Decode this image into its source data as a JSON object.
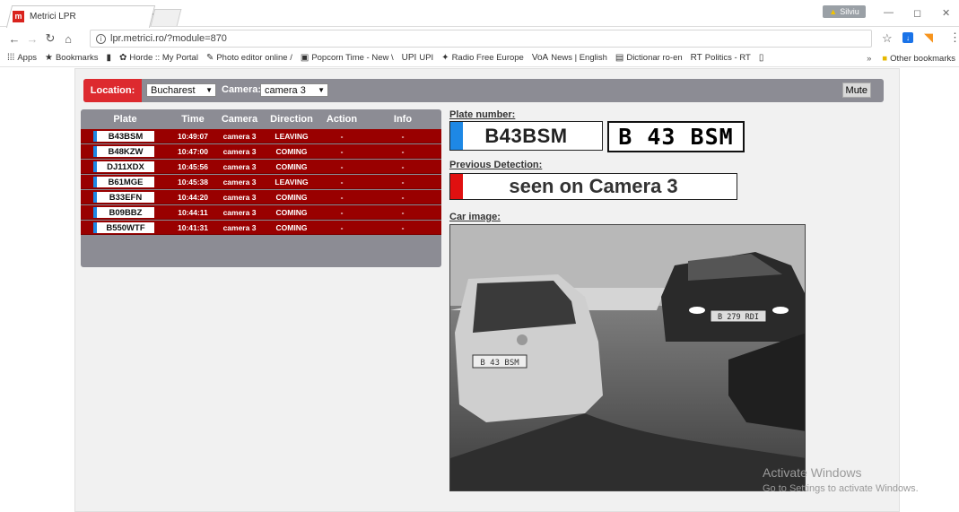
{
  "browser": {
    "tab_title": "Metrici LPR",
    "tab_close": "×",
    "favicon_text": "m",
    "profile_name": "Silviu",
    "url": "lpr.metrici.ro/?module=870",
    "window_controls": [
      "—",
      "◻",
      "✕"
    ]
  },
  "bookmarks": [
    {
      "icon": "apps-icon",
      "glyph": "⁞⁞⁞",
      "label": "Apps"
    },
    {
      "icon": "star-icon",
      "glyph": "★",
      "label": "Bookmarks"
    },
    {
      "icon": "imdb-icon",
      "glyph": "▮",
      "label": ""
    },
    {
      "icon": "horde-icon",
      "glyph": "✿",
      "label": "Horde :: My Portal"
    },
    {
      "icon": "pencil-icon",
      "glyph": "✎",
      "label": "Photo editor online /"
    },
    {
      "icon": "popcorn-icon",
      "glyph": "▣",
      "label": "Popcorn Time - New \\"
    },
    {
      "icon": "upi-icon",
      "glyph": "UPI",
      "label": "UPI"
    },
    {
      "icon": "rfe-icon",
      "glyph": "✦",
      "label": "Radio Free Europe"
    },
    {
      "icon": "voa-icon",
      "glyph": "VoA",
      "label": "News | English"
    },
    {
      "icon": "dictionary-icon",
      "glyph": "▤",
      "label": "Dictionar ro-en"
    },
    {
      "icon": "rt-icon",
      "glyph": "RT",
      "label": "Politics - RT"
    },
    {
      "icon": "page-icon",
      "glyph": "▯",
      "label": ""
    }
  ],
  "bookmarks_more": "»",
  "other_bookmarks": "Other bookmarks",
  "controls": {
    "location_label": "Location:",
    "location_value": "Bucharest",
    "camera_label": "Camera:",
    "camera_value": "camera 3",
    "mute_label": "Mute"
  },
  "table": {
    "headers": [
      "Plate",
      "Time",
      "Camera",
      "Direction",
      "Action",
      "Info"
    ],
    "rows": [
      {
        "plate": "B43BSM",
        "time": "10:49:07",
        "camera": "camera 3",
        "direction": "LEAVING",
        "action": "-",
        "info": "-"
      },
      {
        "plate": "B48KZW",
        "time": "10:47:00",
        "camera": "camera 3",
        "direction": "COMING",
        "action": "-",
        "info": "-"
      },
      {
        "plate": "DJ11XDX",
        "time": "10:45:56",
        "camera": "camera 3",
        "direction": "COMING",
        "action": "-",
        "info": "-"
      },
      {
        "plate": "B61MGE",
        "time": "10:45:38",
        "camera": "camera 3",
        "direction": "LEAVING",
        "action": "-",
        "info": "-"
      },
      {
        "plate": "B33EFN",
        "time": "10:44:20",
        "camera": "camera 3",
        "direction": "COMING",
        "action": "-",
        "info": "-"
      },
      {
        "plate": "B09BBZ",
        "time": "10:44:11",
        "camera": "camera 3",
        "direction": "COMING",
        "action": "-",
        "info": "-"
      },
      {
        "plate": "B550WTF",
        "time": "10:41:31",
        "camera": "camera 3",
        "direction": "COMING",
        "action": "-",
        "info": "-"
      }
    ]
  },
  "detail": {
    "plate_number_label": "Plate number:",
    "plate_number": "B43BSM",
    "plate_crop_text": "B 43 BSM",
    "previous_label": "Previous Detection:",
    "previous_text": "seen on Camera 3",
    "car_image_label": "Car image:",
    "car_plate_left": "B 43 BSM",
    "car_plate_right": "B 279 RDI"
  },
  "colors": {
    "accent_red": "#dd2a2f",
    "row_red": "#990000",
    "bar_gray": "#8c8c94",
    "plate_marker_blue": "#1e88e5",
    "previous_marker_red": "#e01010"
  },
  "watermark": {
    "line1": "Activate Windows",
    "line2": "Go to Settings to activate Windows."
  }
}
